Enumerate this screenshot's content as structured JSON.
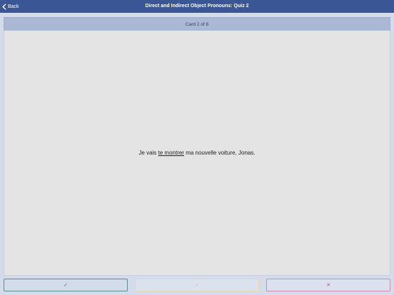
{
  "nav": {
    "back_label": "Back",
    "title": "Direct and Indirect Object Pronouns: Quiz 2"
  },
  "card": {
    "counter": "Card 2 of 8",
    "sentence_before": "Je vais ",
    "sentence_highlight": "te montrer",
    "sentence_after": " ma nouvelle voiture, Jonas."
  },
  "actions": {
    "correct_glyph": "✓",
    "skip_glyph": "•",
    "wrong_glyph": "✕"
  },
  "colors": {
    "navbar": "#3b5694",
    "correct": "#5b8c8e",
    "skip": "#e4c07a",
    "wrong": "#c2508e"
  }
}
